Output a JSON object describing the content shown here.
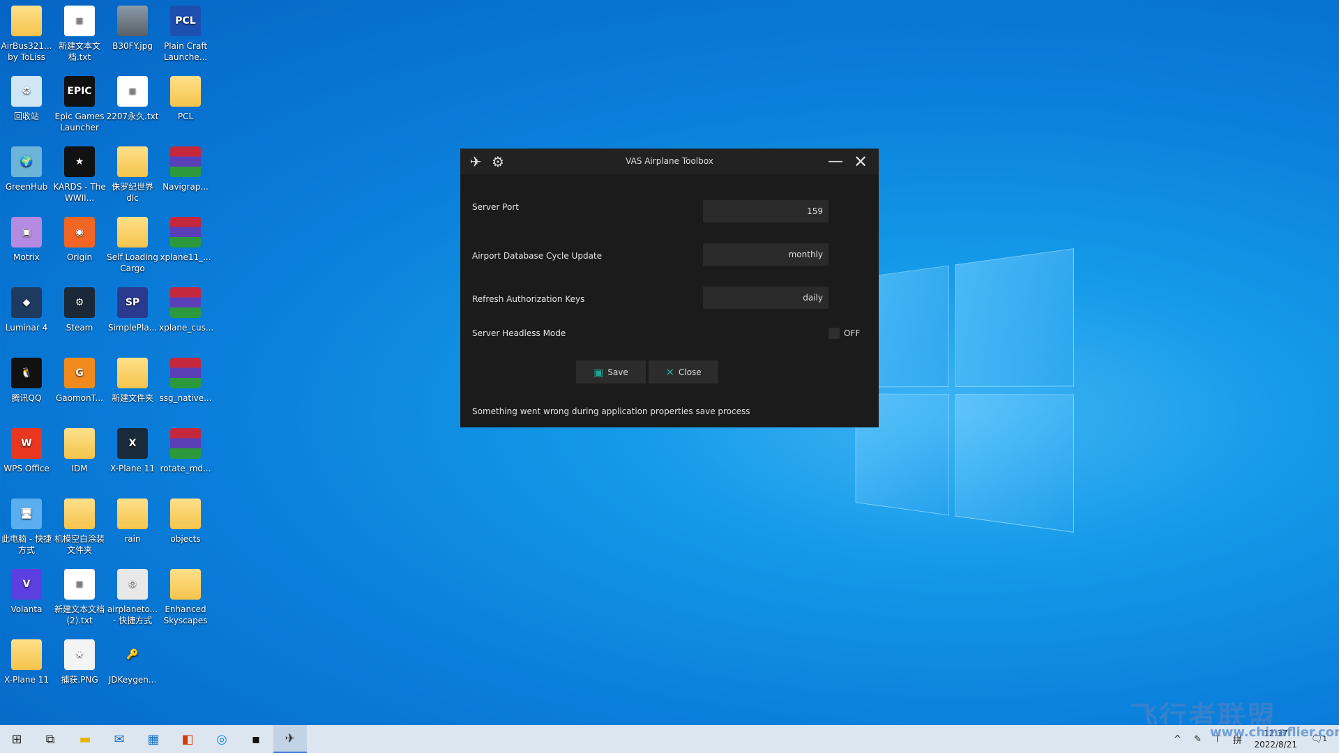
{
  "desktop": {
    "icons": [
      {
        "label": "AirBus321... by ToLiss",
        "type": "folder"
      },
      {
        "label": "新建文本文档.txt",
        "type": "doc"
      },
      {
        "label": "B30FY.jpg",
        "type": "image"
      },
      {
        "label": "Plain Craft Launche...",
        "type": "app",
        "glyph": "PCL",
        "color": "#1d4fb0"
      },
      {
        "label": "回收站",
        "type": "app",
        "glyph": "♻",
        "color": "#cfe6f5"
      },
      {
        "label": "Epic Games Launcher",
        "type": "app",
        "glyph": "EPIC",
        "color": "#111111"
      },
      {
        "label": "2207永久.txt",
        "type": "doc"
      },
      {
        "label": "PCL",
        "type": "folder"
      },
      {
        "label": "GreenHub",
        "type": "app",
        "glyph": "🌍",
        "color": "#6bb4d8"
      },
      {
        "label": "KARDS - The WWII...",
        "type": "app",
        "glyph": "★",
        "color": "#111111"
      },
      {
        "label": "侏罗纪世界dlc",
        "type": "folder"
      },
      {
        "label": "Navigrap...",
        "type": "rar"
      },
      {
        "label": "Motrix",
        "type": "app",
        "glyph": "▣",
        "color": "#b48be0"
      },
      {
        "label": "Origin",
        "type": "app",
        "glyph": "◉",
        "color": "#f26522"
      },
      {
        "label": "Self Loading Cargo",
        "type": "folder"
      },
      {
        "label": "xplane11_...",
        "type": "rar"
      },
      {
        "label": "Luminar 4",
        "type": "app",
        "glyph": "◆",
        "color": "#1e3a5f"
      },
      {
        "label": "Steam",
        "type": "app",
        "glyph": "⚙",
        "color": "#1b2838"
      },
      {
        "label": "SimplePla...",
        "type": "app",
        "glyph": "SP",
        "color": "#2a3b8f"
      },
      {
        "label": "xplane_cus...",
        "type": "rar"
      },
      {
        "label": "腾讯QQ",
        "type": "app",
        "glyph": "🐧",
        "color": "#111111"
      },
      {
        "label": "GaomonT...",
        "type": "app",
        "glyph": "G",
        "color": "#f08a1c"
      },
      {
        "label": "新建文件夹",
        "type": "folder"
      },
      {
        "label": "ssg_native...",
        "type": "rar"
      },
      {
        "label": "WPS Office",
        "type": "app",
        "glyph": "W",
        "color": "#e8361f"
      },
      {
        "label": "IDM",
        "type": "folder"
      },
      {
        "label": "X-Plane 11",
        "type": "app",
        "glyph": "X",
        "color": "#1a2a3a"
      },
      {
        "label": "rotate_md...",
        "type": "rar"
      },
      {
        "label": "此电脑 - 快捷方式",
        "type": "app",
        "glyph": "🖥",
        "color": "#5aaef0"
      },
      {
        "label": "机模空白涂装文件夹",
        "type": "folder"
      },
      {
        "label": "rain",
        "type": "folder"
      },
      {
        "label": "objects",
        "type": "folder"
      },
      {
        "label": "Volanta",
        "type": "app",
        "glyph": "V",
        "color": "#5b3fe0"
      },
      {
        "label": "新建文本文档 (2).txt",
        "type": "doc"
      },
      {
        "label": "airplaneto... - 快捷方式",
        "type": "app",
        "glyph": "⚙",
        "color": "#e8e8e8"
      },
      {
        "label": "Enhanced Skyscapes",
        "type": "folder"
      },
      {
        "label": "X-Plane 11",
        "type": "folder"
      },
      {
        "label": "捕获.PNG",
        "type": "app",
        "glyph": "★",
        "color": "#f4f4f4"
      },
      {
        "label": "JDKeygen...",
        "type": "app",
        "glyph": "🔑",
        "color": "transparent"
      }
    ]
  },
  "dialog": {
    "title": "VAS Airplane Toolbox",
    "fields": [
      {
        "label": "Server Port",
        "value": "159"
      },
      {
        "label": "Airport Database Cycle Update",
        "value": "monthly"
      },
      {
        "label": "Refresh Authorization Keys",
        "value": "daily"
      }
    ],
    "headless": {
      "label": "Server Headless Mode",
      "state": "OFF"
    },
    "save_label": "Save",
    "close_label": "Close",
    "message": "Something went wrong during application properties save process",
    "accent": "#1fa393"
  },
  "taskbar": {
    "time": "12:37",
    "date": "2022/8/21",
    "ime": "拼",
    "notifications": "1"
  },
  "watermark": {
    "text": "飞行者联盟",
    "url": "www.chinaflier.com"
  }
}
